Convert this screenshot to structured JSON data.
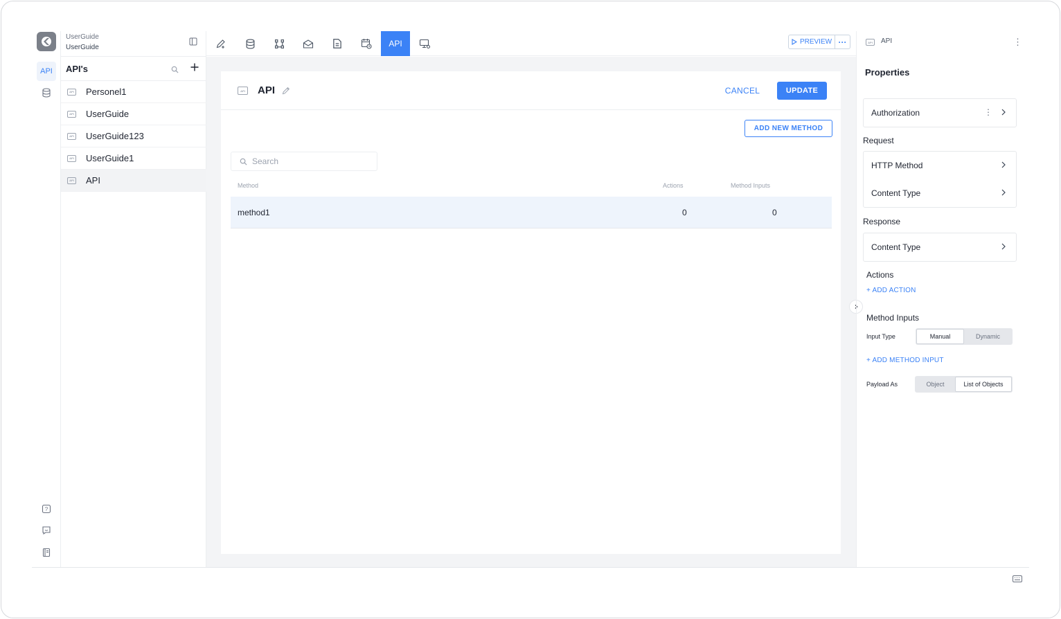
{
  "workspace": {
    "line1": "UserGuide",
    "line2": "UserGuide"
  },
  "rail": {
    "api_label": "API"
  },
  "sidebar": {
    "title": "API's",
    "items": [
      {
        "label": "Personel1"
      },
      {
        "label": "UserGuide"
      },
      {
        "label": "UserGuide123"
      },
      {
        "label": "UserGuide1"
      },
      {
        "label": "API"
      }
    ]
  },
  "toolbar": {
    "active_tab_label": "API",
    "preview_label": "PREVIEW",
    "icons": [
      "edit-add-icon",
      "database-icon",
      "flow-icon",
      "mail-icon",
      "document-icon",
      "calendar-clock-icon",
      "api-tab",
      "monitor-settings-icon"
    ]
  },
  "editor": {
    "api_name": "API",
    "cancel_label": "CANCEL",
    "update_label": "UPDATE",
    "add_method_label": "ADD NEW METHOD",
    "search_placeholder": "Search",
    "columns": {
      "method": "Method",
      "actions": "Actions",
      "inputs": "Method Inputs"
    },
    "rows": [
      {
        "method": "method1",
        "actions": "0",
        "inputs": "0"
      }
    ]
  },
  "panel": {
    "header_title": "API",
    "properties_title": "Properties",
    "authorization_label": "Authorization",
    "request_label": "Request",
    "http_method_label": "HTTP Method",
    "request_content_type_label": "Content Type",
    "response_label": "Response",
    "response_content_type_label": "Content Type",
    "actions_label": "Actions",
    "add_action_label": "+ ADD ACTION",
    "method_inputs_label": "Method Inputs",
    "input_type_label": "Input Type",
    "input_type_options": [
      "Manual",
      "Dynamic"
    ],
    "input_type_selected": "Manual",
    "add_method_input_label": "+ ADD METHOD INPUT",
    "payload_as_label": "Payload As",
    "payload_options": [
      "Object",
      "List of Objects"
    ],
    "payload_selected": "List of Objects"
  },
  "colors": {
    "accent": "#3b82f6",
    "selected_row": "#eef4fc",
    "canvas": "#f3f4f6"
  }
}
